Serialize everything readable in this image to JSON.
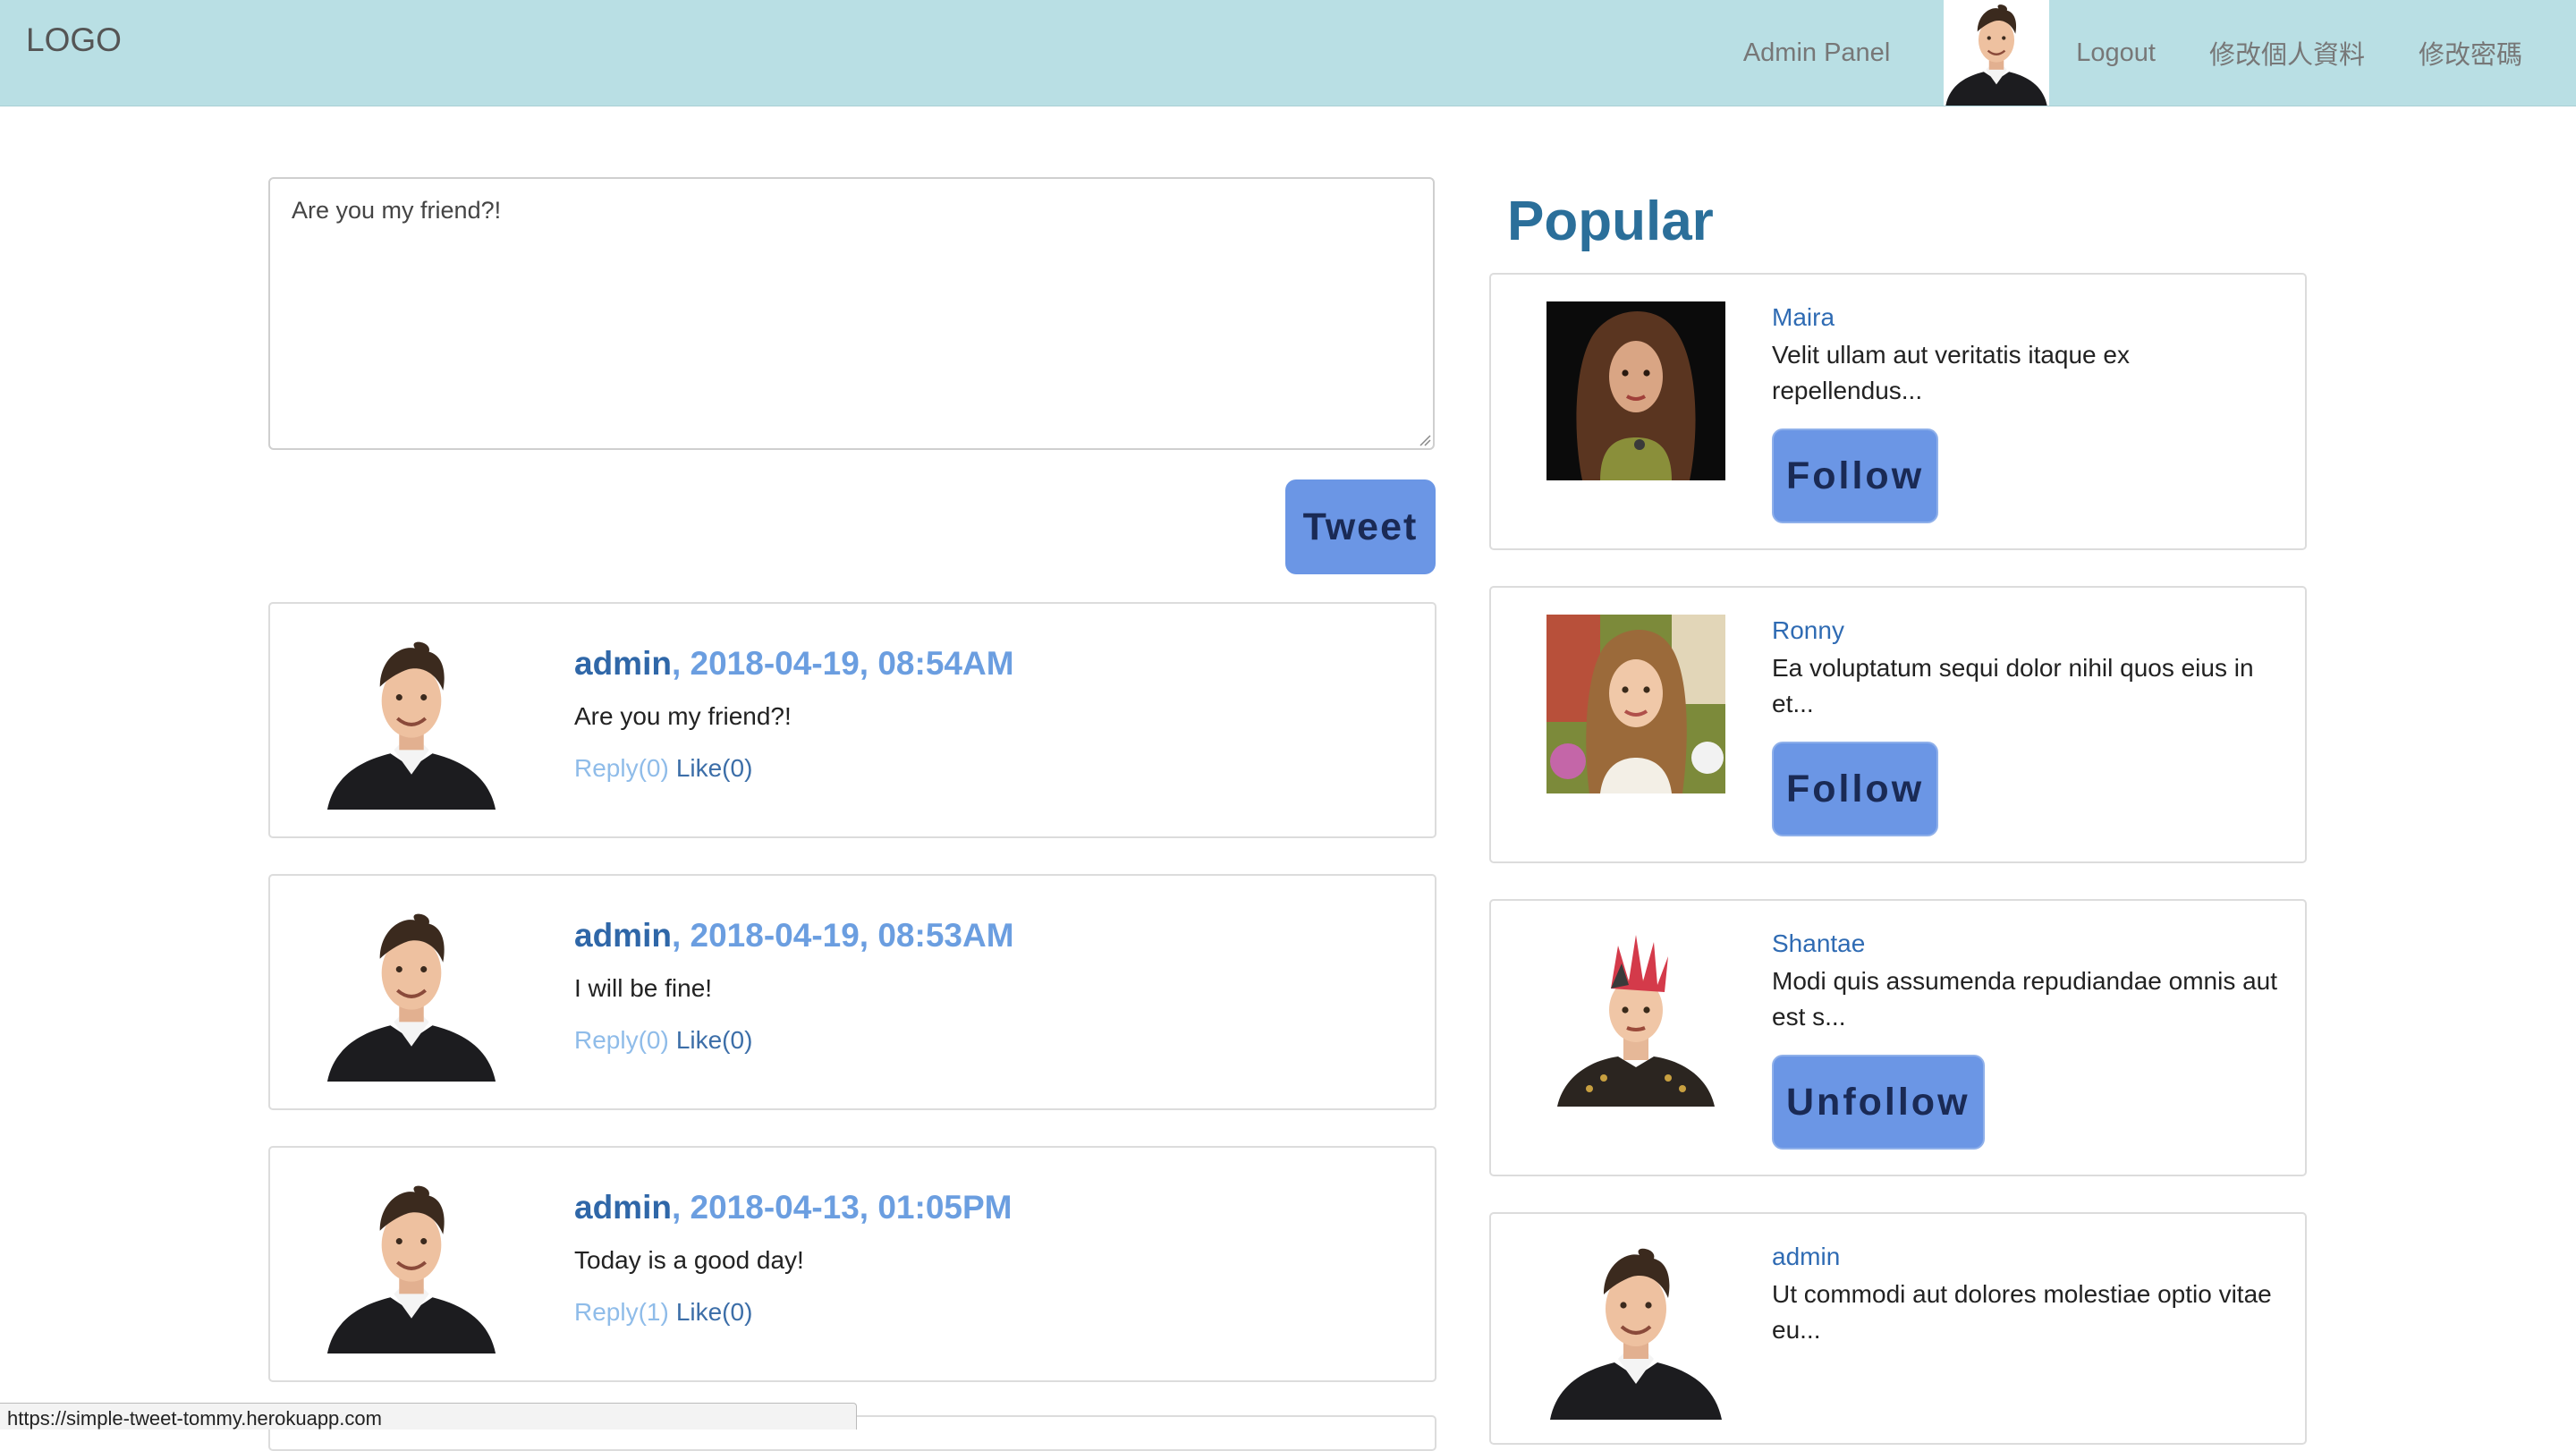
{
  "nav": {
    "logo": "LOGO",
    "admin_panel": "Admin Panel",
    "logout": "Logout",
    "edit_profile": "修改個人資料",
    "change_password": "修改密碼"
  },
  "compose": {
    "text": "Are you my friend?!"
  },
  "tweet_button": "Tweet",
  "tweets": [
    {
      "user": "admin",
      "sep": ", ",
      "time": "2018-04-19, 08:54AM",
      "text": "Are you my friend?!",
      "reply": "Reply(0)",
      "like": "Like(0)"
    },
    {
      "user": "admin",
      "sep": ", ",
      "time": "2018-04-19, 08:53AM",
      "text": "I will be fine!",
      "reply": "Reply(0)",
      "like": "Like(0)"
    },
    {
      "user": "admin",
      "sep": ", ",
      "time": "2018-04-13, 01:05PM",
      "text": "Today is a good day!",
      "reply": "Reply(1)",
      "like": "Like(0)"
    }
  ],
  "popular": {
    "title": "Popular",
    "users": [
      {
        "name": "Maira",
        "desc": "Velit ullam aut veritatis itaque ex repellendus...",
        "button": "Follow"
      },
      {
        "name": "Ronny",
        "desc": "Ea voluptatum sequi dolor nihil quos eius in et...",
        "button": "Follow"
      },
      {
        "name": "Shantae",
        "desc": "Modi quis assumenda repudiandae omnis aut est s...",
        "button": "Unfollow"
      },
      {
        "name": "admin",
        "desc": "Ut commodi aut dolores molestiae optio vitae eu...",
        "button": ""
      }
    ]
  },
  "status_url": "https://simple-tweet-tommy.herokuapp.com",
  "colors": {
    "navbar": "#b9dfe4",
    "button": "#6b96e5",
    "popular_title": "#2b6f9a"
  }
}
